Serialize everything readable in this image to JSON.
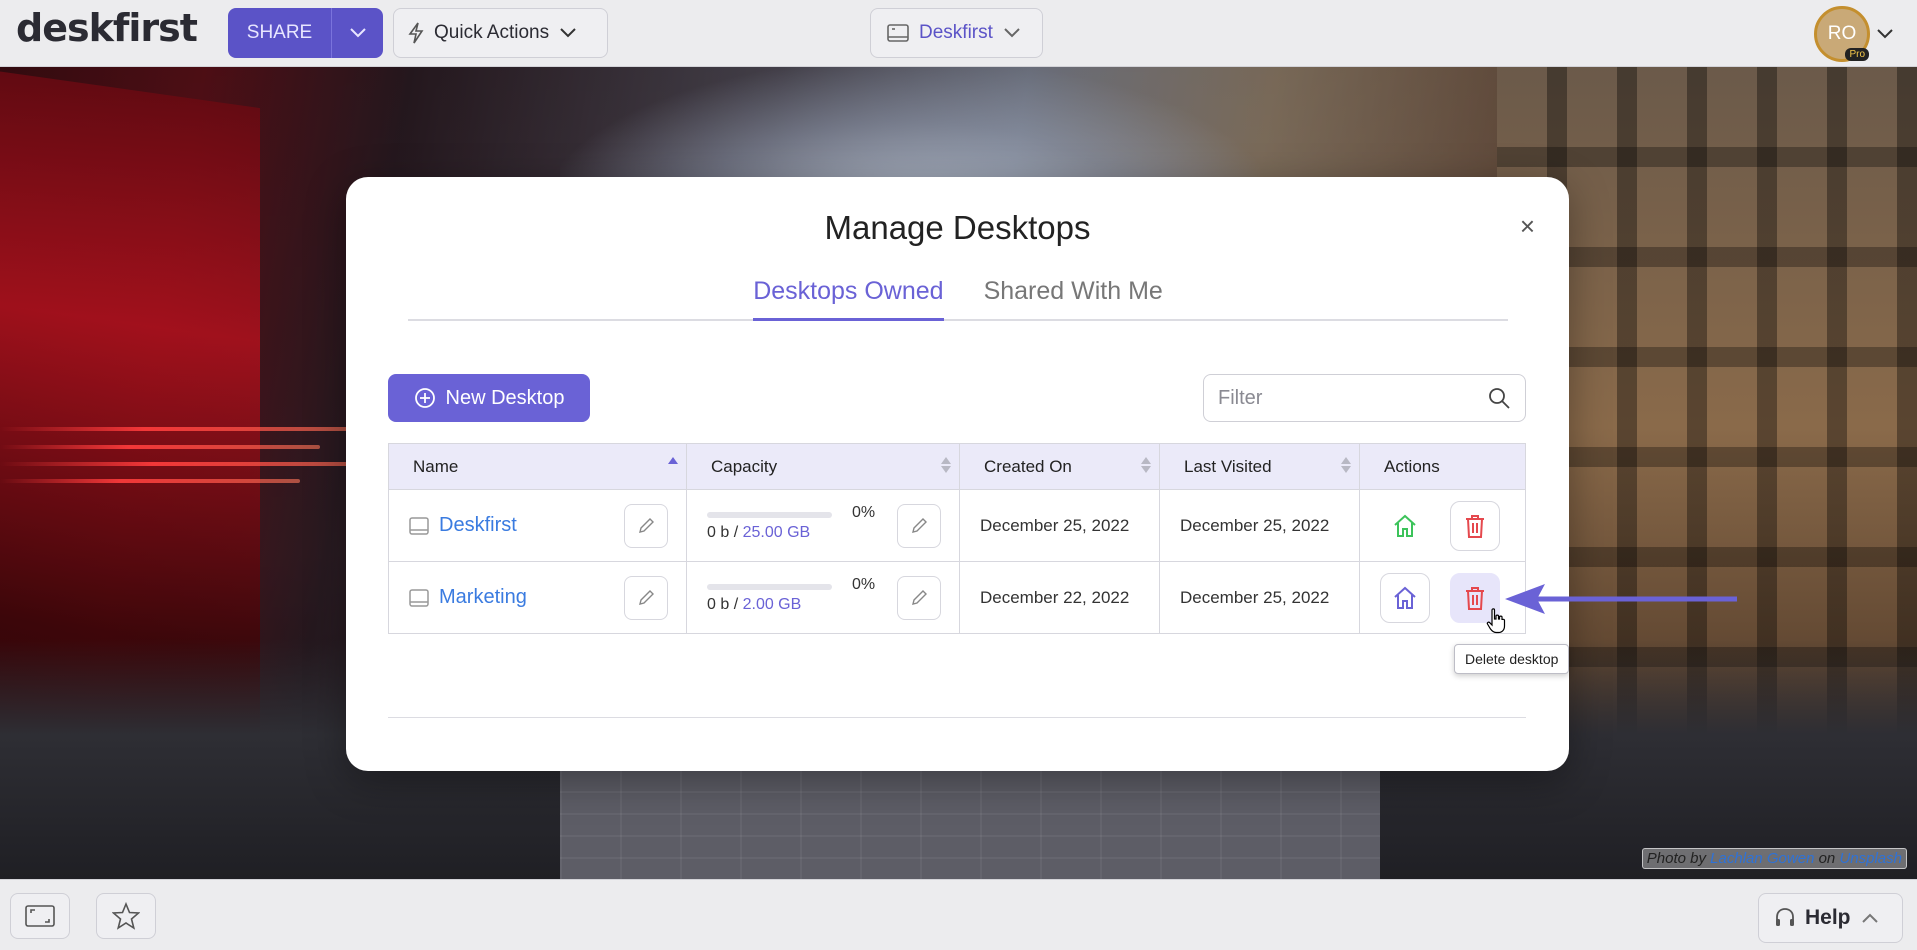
{
  "topbar": {
    "logo": "deskfirst",
    "share_label": "SHARE",
    "quick_actions_label": "Quick Actions",
    "desktop_select": "Deskfirst",
    "avatar_initials": "RO",
    "pro_badge": "Pro"
  },
  "modal": {
    "title": "Manage Desktops",
    "close": "×",
    "tabs": [
      {
        "label": "Desktops Owned",
        "active": true
      },
      {
        "label": "Shared With Me",
        "active": false
      }
    ],
    "new_desktop_label": "New Desktop",
    "filter_placeholder": "Filter",
    "columns": [
      "Name",
      "Capacity",
      "Created On",
      "Last Visited",
      "Actions"
    ],
    "rows": [
      {
        "name": "Deskfirst",
        "cap_pct": "0%",
        "cap_used": "0 b",
        "cap_sep": " / ",
        "cap_total": "25.00 GB",
        "cap_fraction": 0,
        "created": "December 25, 2022",
        "visited": "December 25, 2022",
        "is_home": true
      },
      {
        "name": "Marketing",
        "cap_pct": "0%",
        "cap_used": "0 b",
        "cap_sep": " / ",
        "cap_total": "2.00 GB",
        "cap_fraction": 0,
        "created": "December 22, 2022",
        "visited": "December 25, 2022",
        "is_home": false
      }
    ],
    "tooltip": "Delete desktop"
  },
  "photo_credit": {
    "prefix": "Photo by ",
    "author": "Lachlan Gowen",
    "middle": " on ",
    "source": "Unsplash"
  },
  "bottombar": {
    "help_label": "Help"
  },
  "colors": {
    "accent": "#6a62d6",
    "share_bg": "#5b53c7",
    "link": "#3a7be0",
    "home_active": "#3cc35a",
    "delete": "#e5484d",
    "arrow": "#6a62d6"
  },
  "icons": [
    "bolt-icon",
    "desktop-icon",
    "chevron-down-icon",
    "close-icon",
    "plus-circle-icon",
    "search-icon",
    "pencil-icon",
    "home-icon",
    "trash-icon",
    "pointer-cursor-icon",
    "fullscreen-icon",
    "star-icon",
    "headset-icon",
    "chevron-up-icon"
  ]
}
